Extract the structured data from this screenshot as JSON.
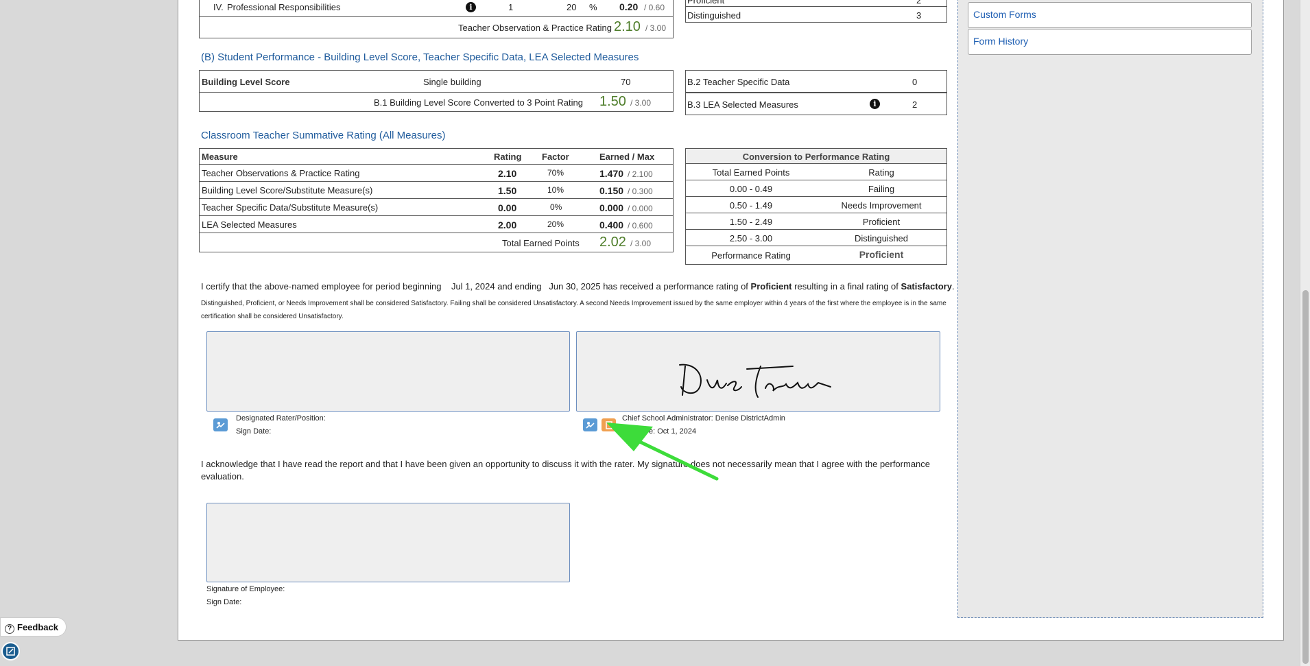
{
  "professional": {
    "roman": "IV.",
    "label": "Professional Responsibilities",
    "count": "1",
    "pct": "20",
    "pct_sign": "%",
    "score": "0.20",
    "max": "/ 0.60"
  },
  "top_summary": {
    "label": "Teacher Observation & Practice Rating",
    "value": "2.10",
    "max": "/ 3.00"
  },
  "top_right_table": {
    "rows": [
      {
        "label": "Proficient",
        "value": "2"
      },
      {
        "label": "Distinguished",
        "value": "3"
      }
    ]
  },
  "section_b": {
    "title": "(B) Student Performance - Building Level Score, Teacher Specific Data, LEA Selected Measures",
    "building_label": "Building Level Score",
    "building_type": "Single building",
    "building_value": "70",
    "converted_label": "B.1 Building Level Score Converted to 3 Point Rating",
    "converted_value": "1.50",
    "converted_max": "/ 3.00",
    "b2_label": "B.2 Teacher Specific Data",
    "b2_value": "0",
    "b3_label": "B.3 LEA Selected Measures",
    "b3_value": "2"
  },
  "summative": {
    "title": "Classroom Teacher Summative Rating (All Measures)",
    "headers": [
      "Measure",
      "Rating",
      "Factor",
      "Earned / Max"
    ],
    "rows": [
      {
        "measure": "Teacher Observations & Practice Rating",
        "rating": "2.10",
        "factor": "70%",
        "earned": "1.470",
        "max": "/ 2.100"
      },
      {
        "measure": "Building Level Score/Substitute Measure(s)",
        "rating": "1.50",
        "factor": "10%",
        "earned": "0.150",
        "max": "/ 0.300"
      },
      {
        "measure": "Teacher Specific Data/Substitute Measure(s)",
        "rating": "0.00",
        "factor": "0%",
        "earned": "0.000",
        "max": "/ 0.000"
      },
      {
        "measure": "LEA Selected Measures",
        "rating": "2.00",
        "factor": "20%",
        "earned": "0.400",
        "max": "/ 0.600"
      }
    ],
    "total_label": "Total Earned Points",
    "total_value": "2.02",
    "total_max": "/ 3.00"
  },
  "conversion": {
    "title": "Conversion to Performance Rating",
    "col1": "Total Earned Points",
    "col2": "Rating",
    "rows": [
      {
        "range": "0.00 - 0.49",
        "rating": "Failing"
      },
      {
        "range": "0.50 - 1.49",
        "rating": "Needs Improvement"
      },
      {
        "range": "1.50 - 2.49",
        "rating": "Proficient"
      },
      {
        "range": "2.50 - 3.00",
        "rating": "Distinguished"
      }
    ],
    "perf_label": "Performance Rating",
    "perf_value": "Proficient"
  },
  "certify": {
    "part1": "I certify that the above-named employee for period beginning",
    "start": "Jul 1, 2024",
    "and_ending": "and ending",
    "end": "Jun 30, 2025",
    "part2": "has received a performance rating of",
    "rating": "Proficient",
    "part3": "resulting in a final rating of",
    "final": "Satisfactory",
    "period": ".",
    "note": "Distinguished, Proficient, or Needs Improvement shall be considered Satisfactory. Failing shall be considered Unsatisfactory. A second Needs Improvement issued by the same employer within 4 years of the first where the employee is in the same certification shall be considered Unsatisfactory."
  },
  "signatures": {
    "rater_label": "Designated Rater/Position:",
    "rater_date": "Sign Date:",
    "admin_label": "Chief School Administrator: Denise DistrictAdmin",
    "admin_date_prefix": "Sign Date:",
    "admin_date_visible": "e: Oct 1, 2024",
    "admin_signature": "Dnie Districtadmin"
  },
  "acknowledge": {
    "text": "I acknowledge that I have read the report and that I have been given an opportunity to discuss it with the rater. My signature does not necessarily mean that I agree with the performance evaluation.",
    "employee_label": "Signature of Employee:",
    "employee_date": "Sign Date:"
  },
  "sidebar": {
    "items": [
      {
        "label": "Custom Forms"
      },
      {
        "label": "Form History"
      }
    ]
  },
  "feedback": {
    "label": "Feedback"
  },
  "colors": {
    "accent": "#1f5b9c",
    "score_green": "#4e7d2a",
    "arrow": "#3ddc3a",
    "orange": "#f0a050",
    "blue_btn": "#5b9bd5"
  }
}
